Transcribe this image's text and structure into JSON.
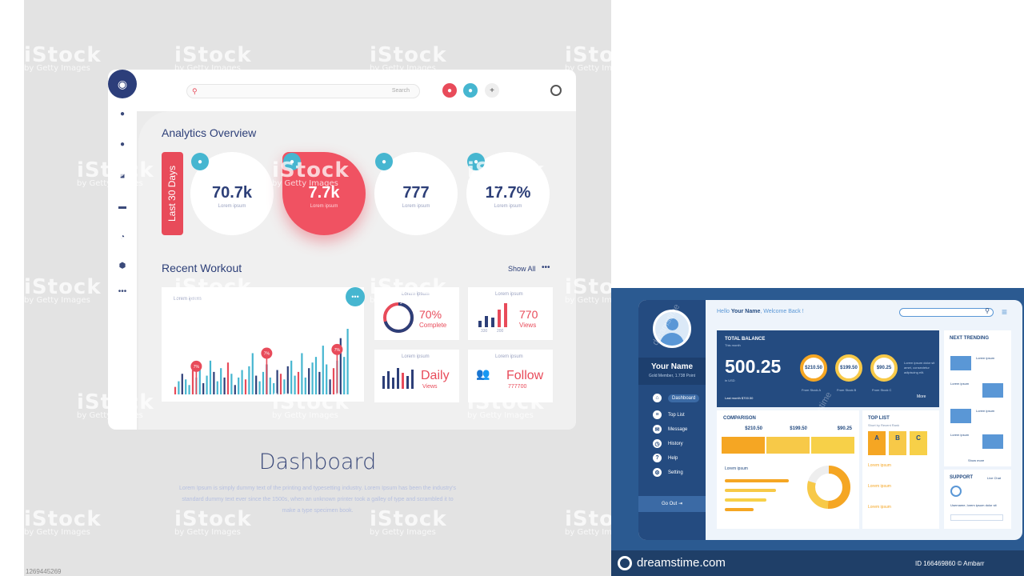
{
  "left": {
    "watermark": {
      "brand": "iStock",
      "sub": "by Getty Images"
    },
    "search_placeholder": "Search",
    "analytics_title": "Analytics Overview",
    "period_tab": "Last 30 Days",
    "stats": [
      {
        "value": "70.7k",
        "label": "Lorem ipsum"
      },
      {
        "value": "7.7k",
        "label": "Lorem ipsum"
      },
      {
        "value": "777",
        "label": "Lorem ipsum"
      },
      {
        "value": "17.7%",
        "label": "Lorem ipsum"
      }
    ],
    "recent_title": "Recent Workout",
    "show_all": "Show All",
    "chart_caption": "Lorem ipsum",
    "chart_data": {
      "type": "bar",
      "values": [
        8,
        14,
        22,
        16,
        10,
        26,
        18,
        30,
        12,
        20,
        36,
        24,
        14,
        28,
        18,
        34,
        22,
        10,
        18,
        26,
        16,
        30,
        44,
        20,
        14,
        24,
        32,
        18,
        12,
        26,
        22,
        16,
        30,
        36,
        20,
        24,
        44,
        18,
        28,
        34,
        40,
        24,
        52,
        32,
        16,
        28,
        36,
        60,
        40,
        70
      ],
      "colors": [
        "#46b6d0",
        "#2d3f78",
        "#e84b5a"
      ],
      "markers": [
        {
          "index": 6,
          "label": "7%"
        },
        {
          "index": 26,
          "label": "7%"
        },
        {
          "index": 46,
          "label": "7%"
        }
      ]
    },
    "mini": [
      {
        "caption": "Lorem ipsum",
        "value": "70%",
        "sub": "Complete"
      },
      {
        "caption": "Lorem ipsum",
        "value": "770",
        "sub": "Views",
        "legend": [
          "330",
          "200"
        ]
      },
      {
        "caption": "Lorem ipsum",
        "value": "Daily",
        "sub": "Views"
      },
      {
        "caption": "Lorem ipsum",
        "value": "Follow",
        "sub": "777700"
      }
    ],
    "caption_title": "Dashboard",
    "caption_body": "Lorem Ipsum is simply dummy text of the printing and typesetting industry. Lorem Ipsum has been the industry's standard dummy text ever since the 1500s, when an unknown printer took a galley of type and scrambled it to make a type specimen book.",
    "stock_id": "1269445269"
  },
  "right": {
    "greeting_prefix": "Hello ",
    "greeting_name": "Your Name",
    "greeting_suffix": ", Welcome Back !",
    "profile_name": "Your Name",
    "profile_sub": "Gold Member, 1.738 Point",
    "nav": [
      "Dashboard",
      "Top List",
      "Message",
      "History",
      "Help",
      "Setting"
    ],
    "go_out": "Go Out",
    "balance_title": "TOTAL BALANCE",
    "balance_sub": "This month",
    "balance_value": "500.25",
    "balance_unit": "in USD",
    "balance_foot": "Last month $700.50",
    "more": "More",
    "rings": [
      {
        "value": "$210.50",
        "label": "From Stock A"
      },
      {
        "value": "$199.50",
        "label": "From Stock B"
      },
      {
        "value": "$90.25",
        "label": "From Stock C"
      }
    ],
    "balance_note": "Lorem ipsum dolor sit amet, consectetur adipiscing elit.",
    "comparison_title": "COMPARISON",
    "comparison_values": [
      "$210.50",
      "$199.50",
      "$90.25"
    ],
    "comparison_caption": "Lorem ipsum",
    "toplist_title": "TOP LIST",
    "toplist_sub": "Short by Recent Rank",
    "toplist_cols": [
      "A",
      "B",
      "C"
    ],
    "toplist_items": [
      "Lorem ipsum",
      "Lorem ipsum",
      "Lorem ipsum"
    ],
    "trending_title": "NEXT TRENDING",
    "trending_items": [
      "Lorem ipsum",
      "Lorem ipsum",
      "Lorem ipsum",
      "Lorem ipsum"
    ],
    "show_more": "Show more",
    "support_title": "SUPPORT",
    "support_status": "Live Chat",
    "support_text": "Username, lorem ipsum dolor sit",
    "footer_brand": "dreamstime.com",
    "footer_id": "ID 166469860 © Ambarr",
    "watermark": "dreamstime"
  }
}
